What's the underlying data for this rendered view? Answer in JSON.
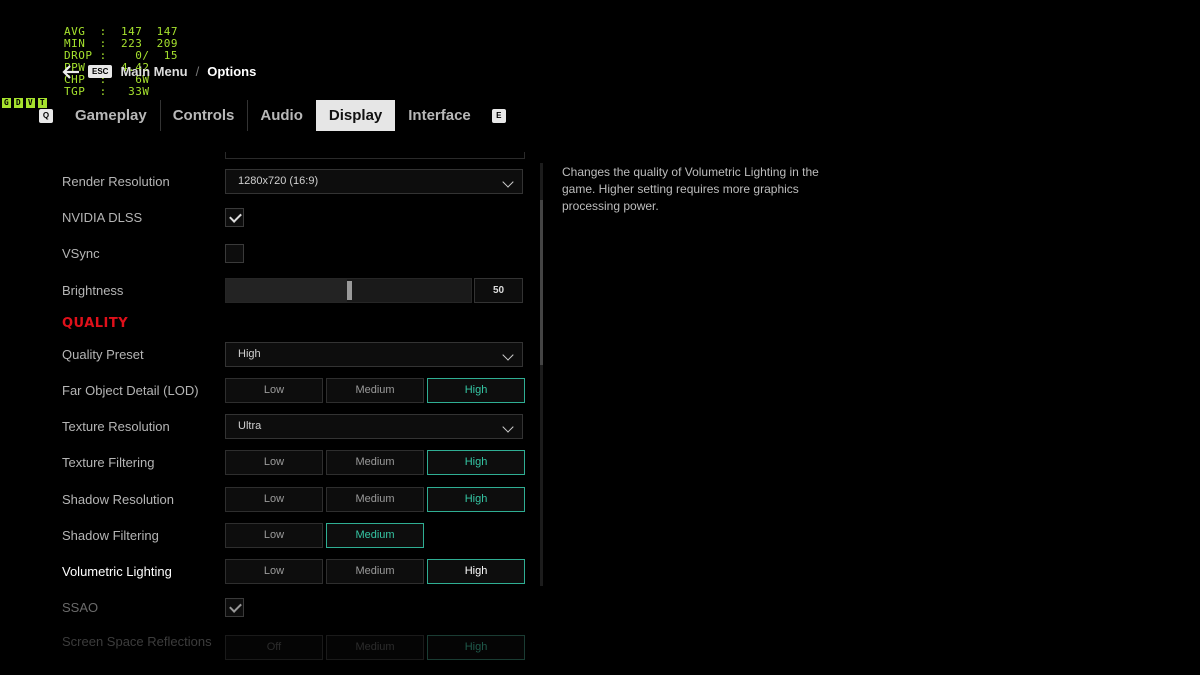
{
  "perf_overlay": {
    "lines": [
      "AVG  :  147  147",
      "MIN  :  223  209",
      "DROP :    0/  15",
      "PPW  :  4.42",
      "CHP  :    6W",
      "TGP  :   33W"
    ],
    "flags": [
      "G",
      "D",
      "V",
      "T"
    ]
  },
  "breadcrumb": {
    "esc_key": "ESC",
    "parent": "Main Menu",
    "separator": "/",
    "current": "Options"
  },
  "tabs": {
    "left_key": "Q",
    "right_key": "E",
    "items": [
      {
        "label": "Gameplay"
      },
      {
        "label": "Controls"
      },
      {
        "label": "Audio"
      },
      {
        "label": "Display",
        "active": true
      },
      {
        "label": "Interface"
      }
    ]
  },
  "settings": {
    "render_resolution": {
      "label": "Render Resolution",
      "value": "1280x720 (16:9)"
    },
    "nvidia_dlss": {
      "label": "NVIDIA DLSS",
      "checked": true
    },
    "vsync": {
      "label": "VSync",
      "checked": false
    },
    "brightness": {
      "label": "Brightness",
      "value": "50",
      "fraction": 0.5
    },
    "quality_header": "QUALITY",
    "quality_preset": {
      "label": "Quality Preset",
      "value": "High"
    },
    "far_object_detail": {
      "label": "Far Object Detail (LOD)",
      "options": [
        "Low",
        "Medium",
        "High"
      ],
      "selected": "High"
    },
    "texture_resolution": {
      "label": "Texture Resolution",
      "value": "Ultra"
    },
    "texture_filtering": {
      "label": "Texture Filtering",
      "options": [
        "Low",
        "Medium",
        "High"
      ],
      "selected": "High"
    },
    "shadow_resolution": {
      "label": "Shadow Resolution",
      "options": [
        "Low",
        "Medium",
        "High"
      ],
      "selected": "High"
    },
    "shadow_filtering": {
      "label": "Shadow Filtering",
      "options": [
        "Low",
        "Medium"
      ],
      "selected": "Medium"
    },
    "volumetric_lighting": {
      "label": "Volumetric Lighting",
      "options": [
        "Low",
        "Medium",
        "High"
      ],
      "selected": "High"
    },
    "ssao": {
      "label": "SSAO",
      "checked": true
    },
    "ssr": {
      "label": "Screen Space Reflections",
      "options": [
        "Off",
        "Medium",
        "High"
      ],
      "selected": "High"
    }
  },
  "description": "Changes the quality of Volumetric Lighting in the game. Higher setting requires more graphics processing power.",
  "colors": {
    "accent_selected": "#35c6a4",
    "section_header": "#e0101a",
    "perf_overlay": "#a6e22e"
  }
}
